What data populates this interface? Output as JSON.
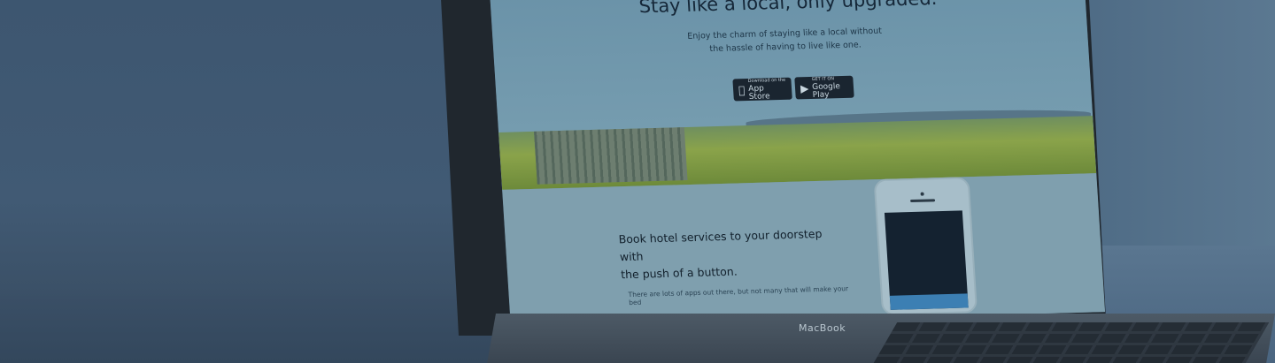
{
  "hero": {
    "title": "Stay like a local, only upgraded.",
    "subtitle_line1": "Enjoy the charm of staying like a local without",
    "subtitle_line2": "the hassle of having to live like one."
  },
  "stores": {
    "app_store": "App Store",
    "app_store_small": "Download on the",
    "google_play": "Google Play",
    "google_play_small": "GET IT ON"
  },
  "section": {
    "heading_line1": "Book hotel services to your doorstep with",
    "heading_line2": "the push of a button.",
    "body": "There are lots of apps out there, but not many that will make your bed"
  },
  "device": {
    "brand": "MacBook"
  },
  "icons": {
    "apple": "apple-icon",
    "play": "google-play-icon"
  }
}
